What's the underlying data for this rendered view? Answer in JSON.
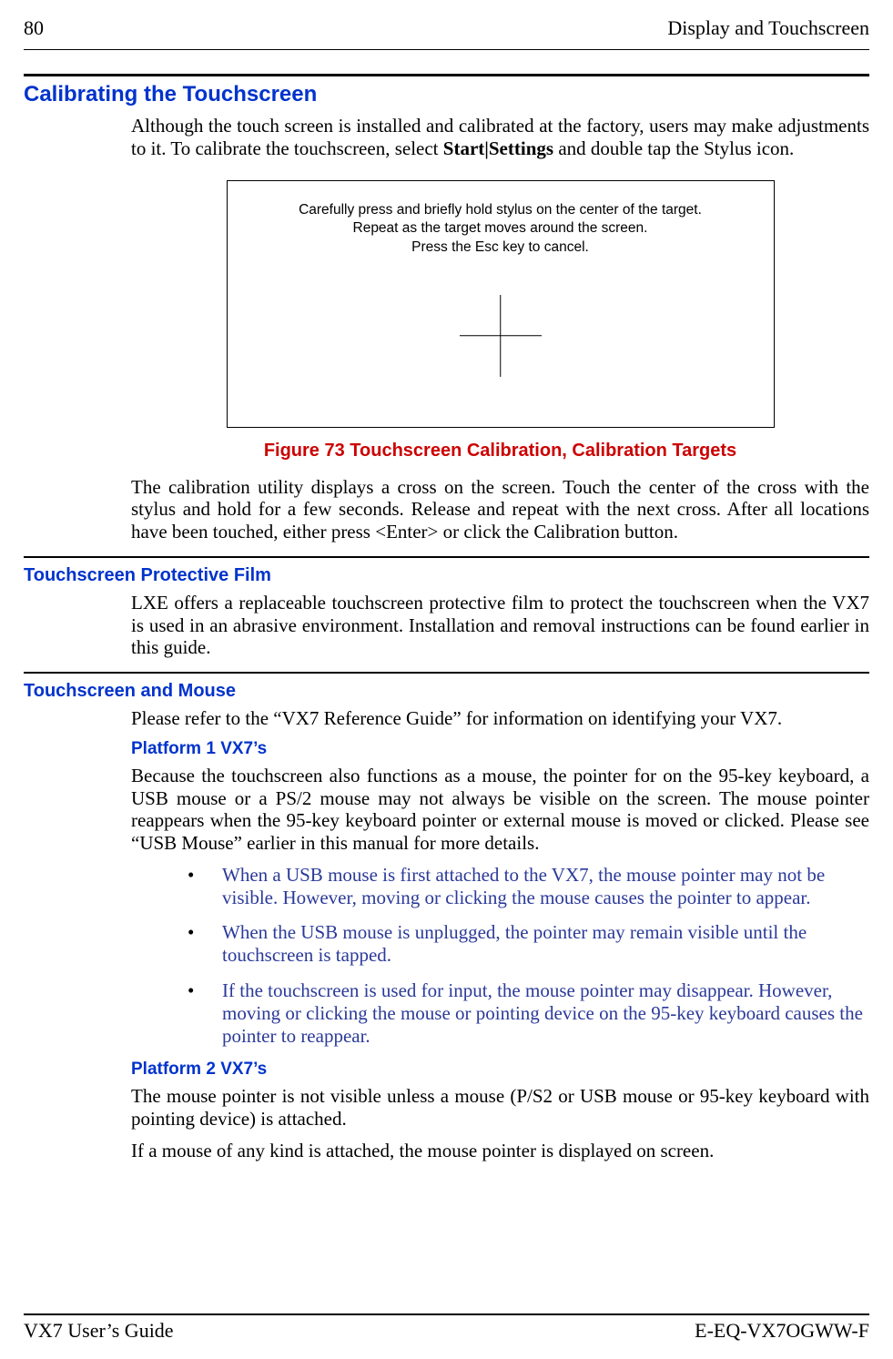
{
  "header": {
    "page_number": "80",
    "section_title": "Display and Touchscreen"
  },
  "section1": {
    "heading": "Calibrating the Touchscreen",
    "para1_pre": "Although the touch screen is installed and calibrated at the factory, users may make adjustments to it.   To calibrate the touchscreen, select ",
    "para1_bold": "Start|Settings",
    "para1_post": " and double tap the Stylus icon.",
    "figure": {
      "line1": "Carefully press and briefly hold stylus on the center of the target.",
      "line2": "Repeat as the target moves around the screen.",
      "line3": "Press the Esc key to cancel.",
      "caption": "Figure 73  Touchscreen Calibration, Calibration Targets"
    },
    "para2": "The calibration utility displays a cross on the screen.  Touch the center of the cross with the stylus and hold for a few seconds.  Release and repeat with the next cross.  After all locations have been touched, either press <Enter> or click the Calibration button."
  },
  "section2": {
    "heading": "Touchscreen Protective Film",
    "para": "LXE offers a replaceable touchscreen protective film to protect the touchscreen when the VX7 is used in an abrasive environment.  Installation and removal instructions can be found earlier in this guide."
  },
  "section3": {
    "heading": "Touchscreen and Mouse",
    "para_intro": "Please refer to the “VX7 Reference Guide” for information on identifying your VX7.",
    "platform1": {
      "heading": "Platform 1 VX7’s",
      "para": "Because the touchscreen also functions as a mouse, the pointer for on the 95-key keyboard, a USB mouse or a PS/2 mouse may not always be visible on the screen.  The mouse pointer reappears when the 95-key keyboard pointer or external mouse is moved or clicked.  Please see “USB Mouse” earlier in this manual for more details.",
      "bullets": [
        "When a USB mouse is first attached to the VX7, the mouse pointer may not be visible.  However, moving or clicking the mouse causes the pointer to appear.",
        "When the USB mouse is unplugged, the pointer may remain visible until the touchscreen is tapped.",
        "If the touchscreen is used for input, the mouse pointer may disappear.  However, moving or clicking the mouse or pointing device on the 95-key keyboard causes the pointer to reappear."
      ]
    },
    "platform2": {
      "heading": "Platform 2 VX7’s",
      "para1": "The mouse pointer is not visible unless a mouse (P/S2 or USB mouse or 95-key keyboard with pointing device) is attached.",
      "para2": "If a mouse of any kind is attached, the mouse pointer is displayed on screen."
    }
  },
  "footer": {
    "left": "VX7 User’s Guide",
    "right": "E-EQ-VX7OGWW-F"
  }
}
